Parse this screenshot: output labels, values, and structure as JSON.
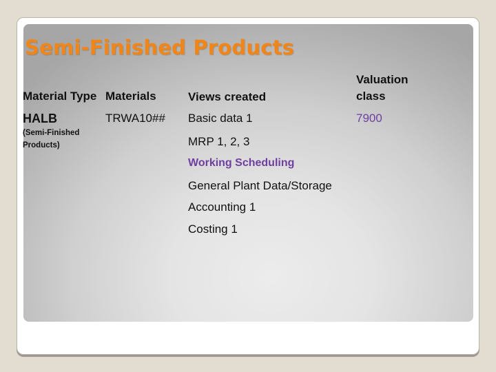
{
  "slide": {
    "title": "Semi-Finished Products",
    "colors": {
      "title": "#f0861a",
      "accent_purple": "#6f3fa0",
      "background": "#e3ddd1",
      "text": "#111111"
    },
    "table": {
      "headers": {
        "material_type": "Material Type",
        "materials": "Materials",
        "views_created": "Views created",
        "valuation_class_line1": "Valuation",
        "valuation_class_line2": "class"
      },
      "row": {
        "material_type": "HALB",
        "material_type_desc_line1": "(Semi-Finished",
        "material_type_desc_line2": "Products)",
        "materials": "TRWA10##",
        "valuation_class": "7900",
        "views": [
          "Basic data 1",
          "MRP 1, 2, 3",
          "Working Scheduling",
          "General Plant Data/Storage",
          "Accounting 1",
          "Costing 1"
        ]
      }
    }
  }
}
